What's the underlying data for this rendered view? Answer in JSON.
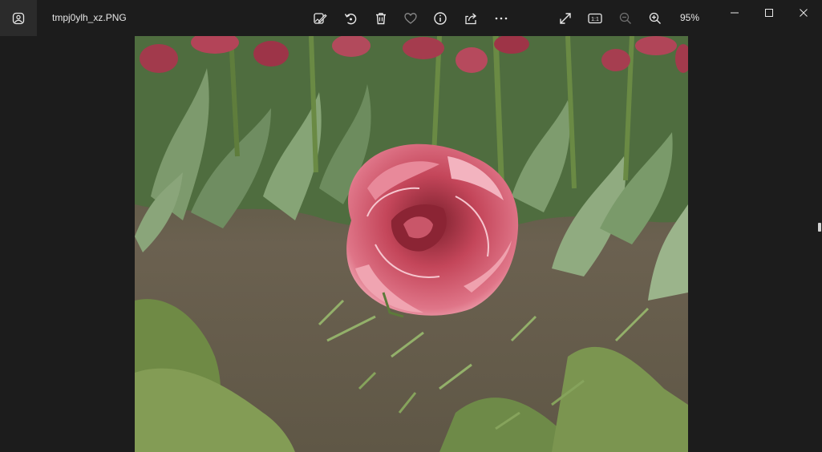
{
  "window": {
    "filename": "tmpj0ylh_xz.PNG",
    "zoom_level": "95%"
  },
  "toolbar": {
    "items": [
      {
        "name": "edit-image",
        "icon": "edit-image-icon"
      },
      {
        "name": "rotate",
        "icon": "rotate-icon"
      },
      {
        "name": "delete",
        "icon": "trash-icon"
      },
      {
        "name": "favorite",
        "icon": "heart-icon"
      },
      {
        "name": "info",
        "icon": "info-icon"
      },
      {
        "name": "share",
        "icon": "share-icon"
      },
      {
        "name": "more",
        "icon": "more-icon"
      },
      {
        "name": "full-screen",
        "icon": "expand-icon"
      },
      {
        "name": "actual-size",
        "icon": "actual-size-icon",
        "label": "1:1"
      },
      {
        "name": "zoom-out",
        "icon": "zoom-out-icon"
      },
      {
        "name": "zoom-in",
        "icon": "zoom-in-icon"
      }
    ]
  },
  "window_controls": [
    "minimize-icon",
    "maximize-icon",
    "close-icon"
  ],
  "colors": {
    "background": "#1c1c1c",
    "accent_panel": "#2b2b2b",
    "text": "#e8e8e8"
  }
}
